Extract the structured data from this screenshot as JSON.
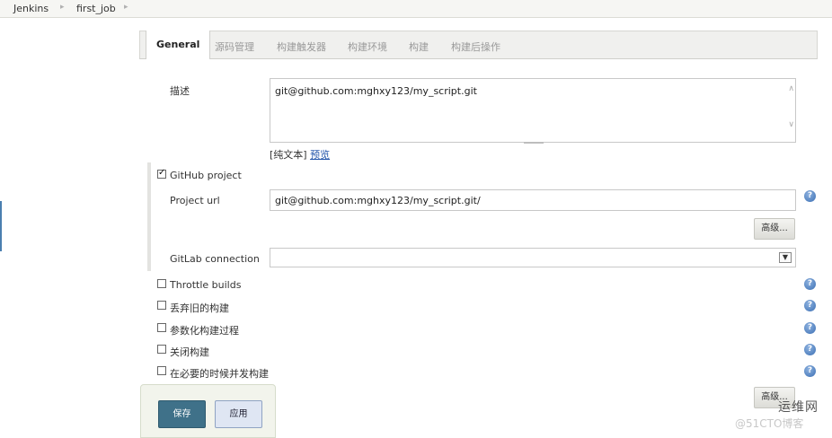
{
  "breadcrumb": {
    "items": [
      "Jenkins",
      "first_job"
    ]
  },
  "tabs": [
    "General",
    "源码管理",
    "构建触发器",
    "构建环境",
    "构建",
    "构建后操作"
  ],
  "general": {
    "description_label": "描述",
    "description_value": "git@github.com:mghxy123/my_script.git",
    "plain_text_label": "[纯文本]",
    "preview_link": "预览"
  },
  "github_project": {
    "label": "GitHub project",
    "checked": true,
    "project_url_label": "Project url",
    "project_url_value": "git@github.com:mghxy123/my_script.git/",
    "advanced_button": "高级...",
    "gitlab_label": "GitLab connection",
    "gitlab_value": ""
  },
  "options": [
    {
      "label": "Throttle builds",
      "checked": false
    },
    {
      "label": "丢弃旧的构建",
      "checked": false
    },
    {
      "label": "参数化构建过程",
      "checked": false
    },
    {
      "label": "关闭构建",
      "checked": false
    },
    {
      "label": "在必要的时候并发构建",
      "checked": false
    }
  ],
  "bottom": {
    "advanced_button": "高级...",
    "save_button": "保存",
    "apply_button": "应用"
  },
  "watermark": {
    "title": "运维网",
    "subtitle": "@51CTO博客"
  }
}
